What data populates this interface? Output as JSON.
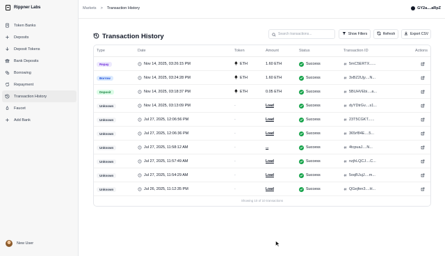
{
  "sidebar": {
    "brand": "Rippner Labs",
    "items": [
      {
        "label": "Token Banks",
        "icon": "file-icon"
      },
      {
        "label": "Deposits",
        "icon": "plus-icon"
      },
      {
        "label": "Deposit Tokens",
        "icon": "arrow-down-icon"
      },
      {
        "label": "Bank Deposits",
        "icon": "bank-icon"
      },
      {
        "label": "Borrowing",
        "icon": "coins-icon"
      },
      {
        "label": "Repayment",
        "icon": "repay-icon"
      },
      {
        "label": "Transaction History",
        "icon": "history-icon"
      },
      {
        "label": "Faucet",
        "icon": "faucet-icon"
      },
      {
        "label": "Add Bank",
        "icon": "plus-icon"
      }
    ],
    "footer_user": "New User"
  },
  "topbar": {
    "crumb_1": "Markets",
    "crumb_sep": ">",
    "crumb_2": "Transaction History",
    "wallet": "GY2a....aRpZ"
  },
  "header": {
    "title": "Transaction History",
    "search_placeholder": "Search transactions...",
    "filters_label": "Show Filters",
    "refresh_label": "Refresh",
    "export_label": "Export CSV"
  },
  "table": {
    "columns": [
      "Type",
      "Date",
      "Token",
      "Amount",
      "Status",
      "Transaction ID",
      "Actions"
    ],
    "rows": [
      {
        "type": "Repay",
        "kind": "repay",
        "date": "Nov 14, 2025, 03:26:15 PM",
        "token": "ETH",
        "amount": "1.60 ETH",
        "status": "Success",
        "txid": "5mC5ERTX......"
      },
      {
        "type": "Borrow",
        "kind": "borrow",
        "date": "Nov 14, 2025, 03:24:28 PM",
        "token": "ETH",
        "amount": "1.60 ETH",
        "status": "Success",
        "txid": "3xBZ2Ujy....N..."
      },
      {
        "type": "Deposit",
        "kind": "deposit",
        "date": "Nov 14, 2025, 03:18:37 PM",
        "token": "ETH",
        "amount": "0.05 ETH",
        "status": "Success",
        "txid": "5BUHVEbi....a..."
      },
      {
        "type": "Unknown",
        "kind": "unknown",
        "date": "Nov 14, 2025, 03:13:09 PM",
        "token": "-",
        "amount": "Load",
        "status": "Success",
        "txid": "dyYDtrGv....s1..."
      },
      {
        "type": "Unknown",
        "kind": "unknown",
        "date": "Jul 27, 2025, 12:06:56 PM",
        "token": "-",
        "amount": "Load",
        "status": "Success",
        "txid": "23T5CGKT......"
      },
      {
        "type": "Unknown",
        "kind": "unknown",
        "date": "Jul 27, 2025, 12:06:36 PM",
        "token": "-",
        "amount": "Load",
        "status": "Success",
        "txid": "365rf84E....5..."
      },
      {
        "type": "Unknown",
        "kind": "unknown",
        "date": "Jul 27, 2025, 11:58:12 AM",
        "token": "-",
        "amount": "...",
        "status": "Success",
        "txid": "4tcpuaJ....N..."
      },
      {
        "type": "Unknown",
        "kind": "unknown",
        "date": "Jul 27, 2025, 11:57:49 AM",
        "token": "-",
        "amount": "Load",
        "status": "Success",
        "txid": "nzjhLQCJ....C..."
      },
      {
        "type": "Unknown",
        "kind": "unknown",
        "date": "Jul 27, 2025, 11:54:29 AM",
        "token": "-",
        "amount": "Load",
        "status": "Success",
        "txid": "5oqBJujJ....m..."
      },
      {
        "type": "Unknown",
        "kind": "unknown",
        "date": "Jul 26, 2025, 11:12:35 PM",
        "token": "-",
        "amount": "Load",
        "status": "Success",
        "txid": "QGejfen3....H..."
      }
    ],
    "footer": "Showing 10 of 10 transactions"
  },
  "colors": {
    "repay_badge": "#ede9fe",
    "borrow_badge": "#dbeafe",
    "deposit_badge": "#dcfce7",
    "unknown_badge": "#f3f4f6",
    "success": "#16a34a"
  }
}
